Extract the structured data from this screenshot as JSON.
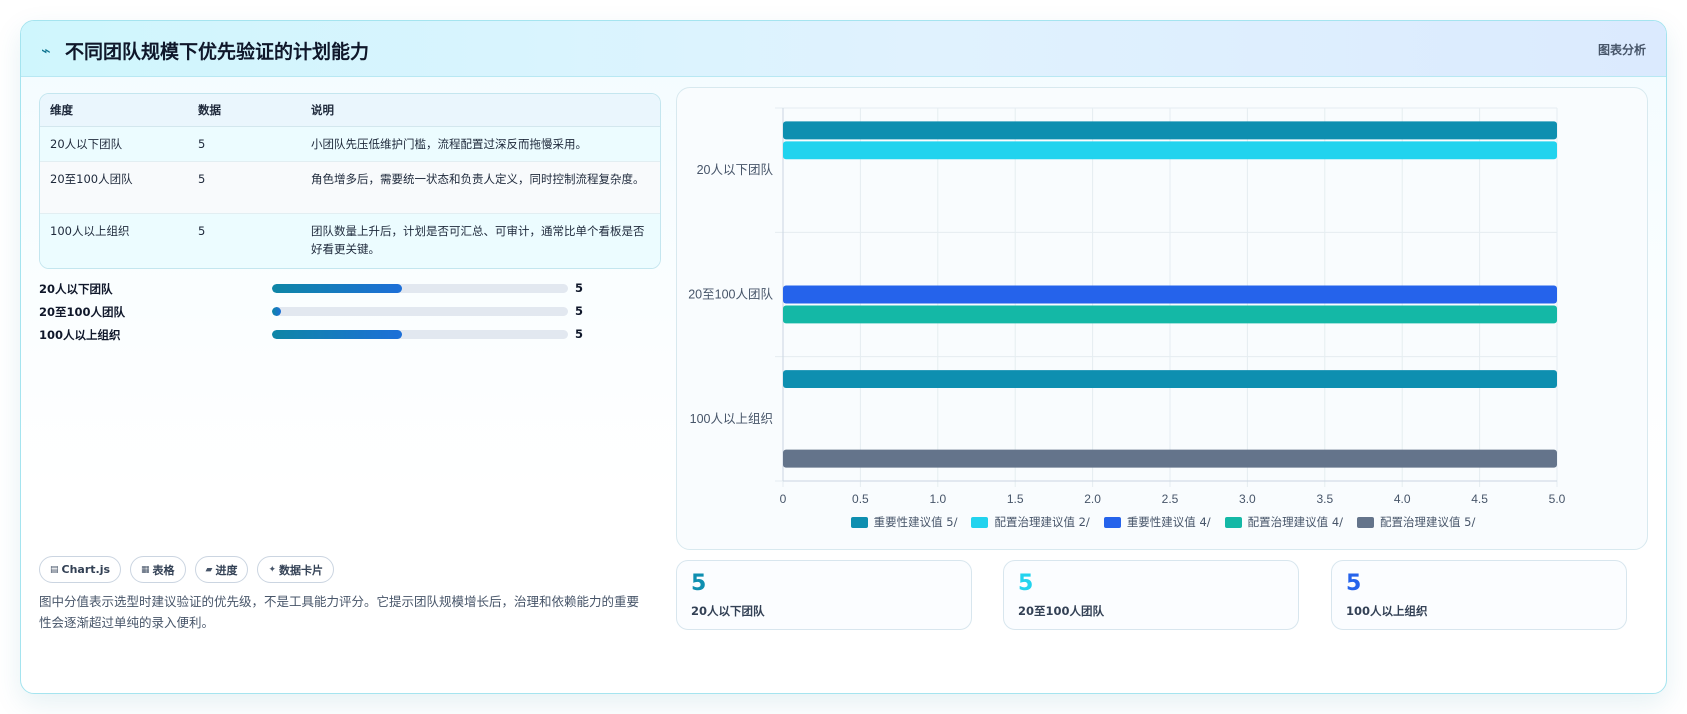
{
  "header": {
    "title": "不同团队规模下优先验证的计划能力",
    "tag": "图表分析",
    "icon": "pulse-icon"
  },
  "table": {
    "headers": [
      "维度",
      "数据",
      "说明"
    ],
    "rows": [
      {
        "dim": "20人以下团队",
        "value": "5",
        "desc": "小团队先压低维护门槛，流程配置过深反而拖慢采用。"
      },
      {
        "dim": "20至100人团队",
        "value": "5",
        "desc": "角色增多后，需要统一状态和负责人定义，同时控制流程复杂度。"
      },
      {
        "dim": "100人以上组织",
        "value": "5",
        "desc": "团队数量上升后，计划是否可汇总、可审计，通常比单个看板是否好看更关键。"
      }
    ]
  },
  "progress": [
    {
      "label": "20人以下团队",
      "value": "5",
      "fraction": 0.44
    },
    {
      "label": "20至100人团队",
      "value": "5",
      "fraction": 0.03
    },
    {
      "label": "100人以上组织",
      "value": "5",
      "fraction": 0.44
    }
  ],
  "badges": [
    {
      "label": "Chart.js",
      "icon": "chart-icon"
    },
    {
      "label": "表格",
      "icon": "table-icon"
    },
    {
      "label": "进度",
      "icon": "progress-icon"
    },
    {
      "label": "数据卡片",
      "icon": "sparkle-icon"
    }
  ],
  "note": "图中分值表示选型时建议验证的优先级，不是工具能力评分。它提示团队规模增长后，治理和依赖能力的重要性会逐渐超过单纯的录入便利。",
  "stats": [
    {
      "value": "5",
      "label": "20人以下团队",
      "color": "#0e8fb0"
    },
    {
      "value": "5",
      "label": "20至100人团队",
      "color": "#22d3ee"
    },
    {
      "value": "5",
      "label": "100人以上组织",
      "color": "#2563eb"
    }
  ],
  "chart_data": {
    "type": "bar",
    "orientation": "horizontal",
    "categories": [
      "20人以下团队",
      "20至100人团队",
      "100人以上组织"
    ],
    "xlim": [
      0,
      5
    ],
    "x_ticks": [
      "0",
      "0.5",
      "1.0",
      "1.5",
      "2.0",
      "2.5",
      "3.0",
      "3.5",
      "4.0",
      "4.5",
      "5.0"
    ],
    "grid": true,
    "legend_position": "bottom",
    "series": [
      {
        "name": "重要性建议值 5/",
        "color": "#0e8fb0",
        "values": [
          5,
          null,
          5
        ]
      },
      {
        "name": "配置治理建议值 2/",
        "color": "#22d3ee",
        "values": [
          5,
          null,
          null
        ]
      },
      {
        "name": "重要性建议值 4/",
        "color": "#2563eb",
        "values": [
          null,
          5,
          null
        ]
      },
      {
        "name": "配置治理建议值 4/",
        "color": "#14b8a6",
        "values": [
          null,
          5,
          null
        ]
      },
      {
        "name": "配置治理建议值 5/",
        "color": "#64748b",
        "values": [
          null,
          null,
          5
        ]
      }
    ]
  }
}
